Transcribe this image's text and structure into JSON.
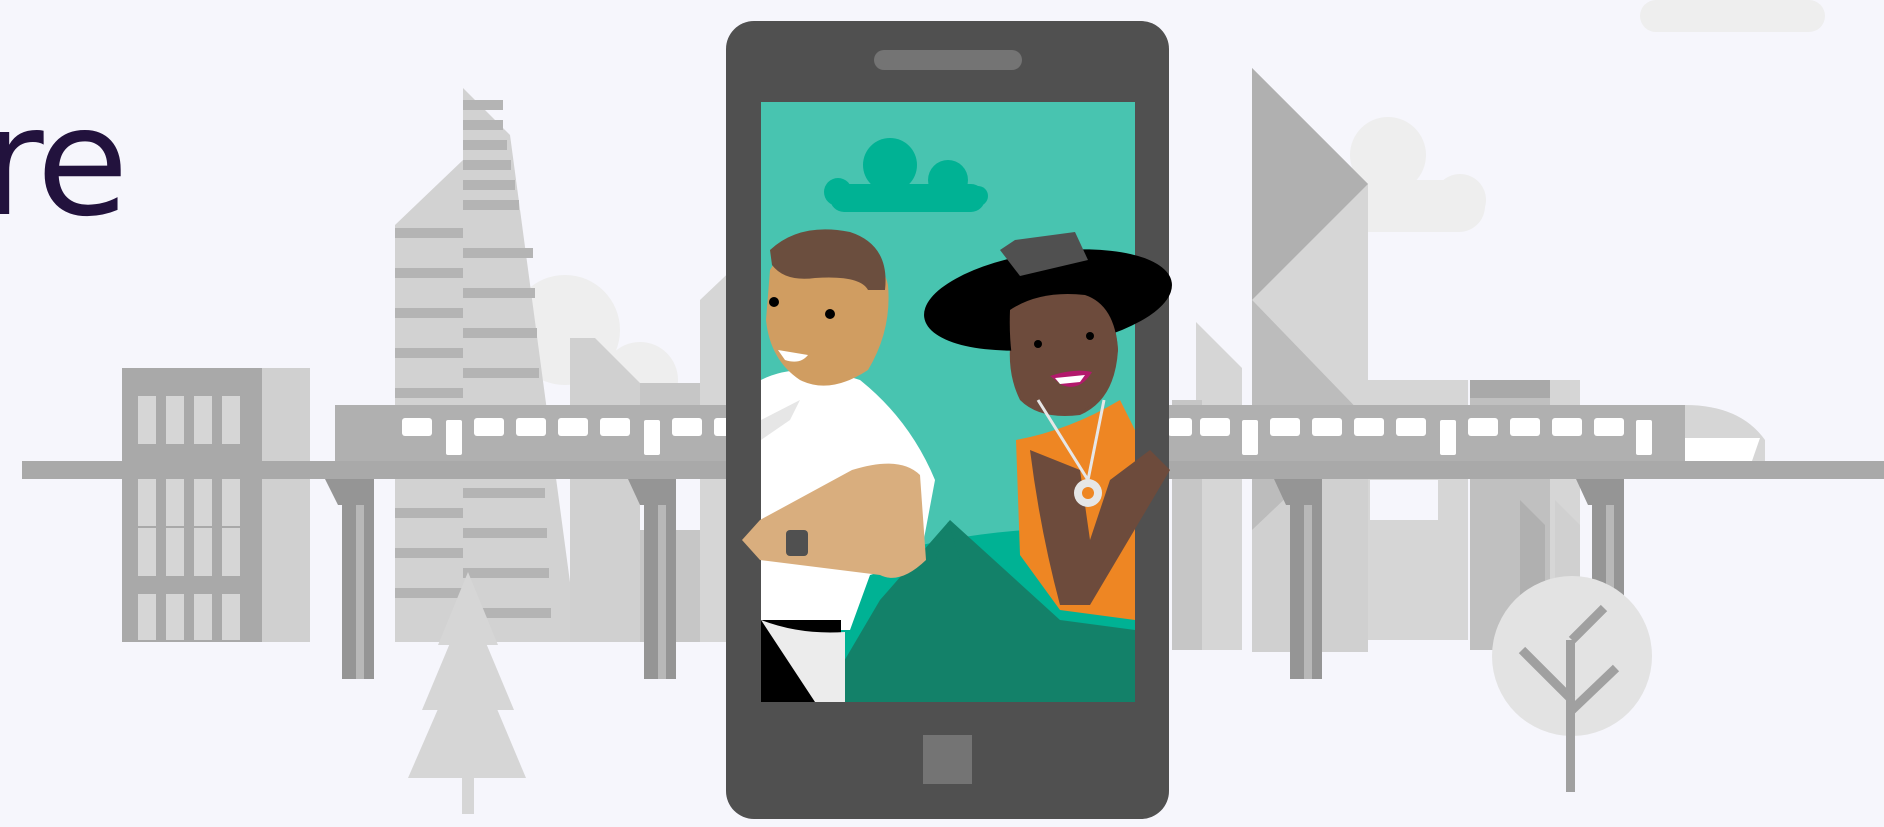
{
  "hero": {
    "headline_fragment": "re"
  },
  "colors": {
    "background": "#f6f6fc",
    "headline": "#22123d",
    "city_dark": "#a9a9a9",
    "city_mid": "#c6c6c6",
    "city_light": "#d6d6d6",
    "phone_body": "#505050",
    "phone_screen": "#48c4b0",
    "cloud_teal": "#00b294",
    "hill_green": "#138169",
    "shirt_orange": "#ee8623"
  },
  "icons": {
    "illustration": "phone-with-people-illustration",
    "city": "city-skyline-illustration",
    "train": "elevated-train-illustration"
  }
}
